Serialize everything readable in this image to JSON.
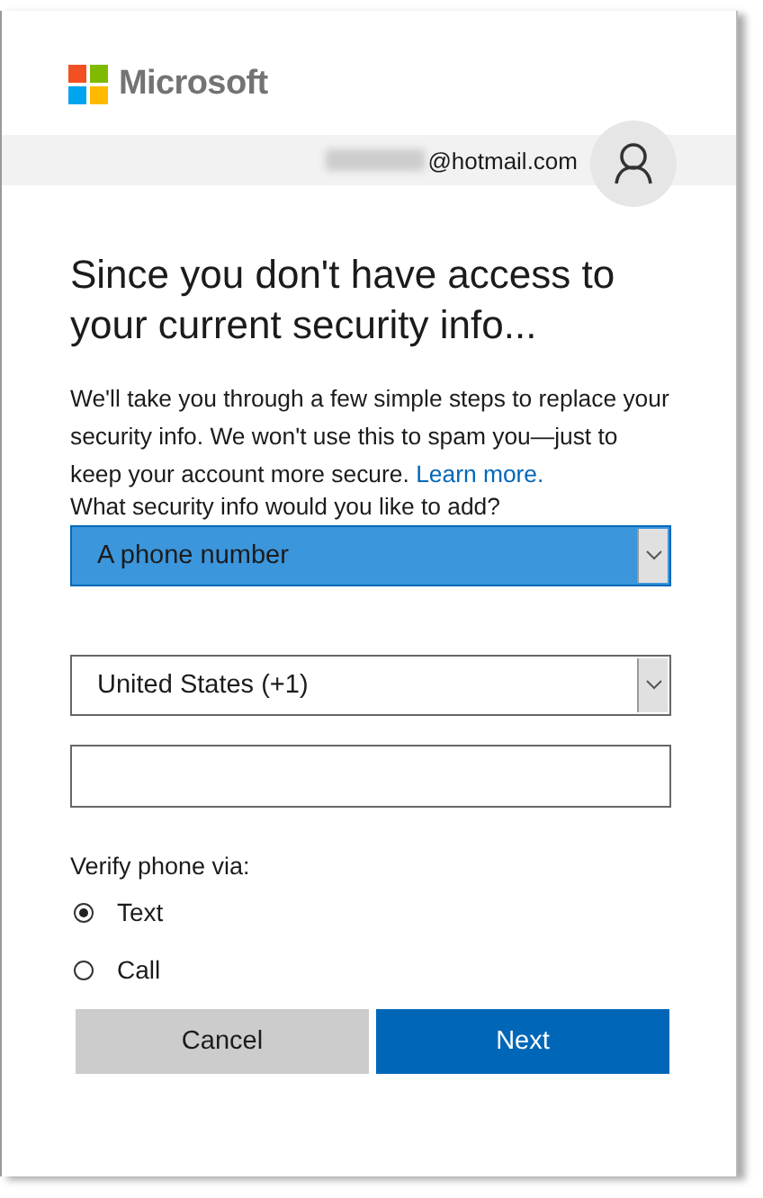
{
  "header": {
    "logo": "Microsoft",
    "account": "@hotmail.com"
  },
  "heading": "Since you don't have access to your current security info...",
  "intro": {
    "text": "We'll take you through a few simple steps to replace your security info. We won't use this to spam you—just to keep your account more secure.",
    "link": "Learn more."
  },
  "question": {
    "label": "What security info would you like to add?",
    "value": "A phone number",
    "focused": true
  },
  "country": {
    "value": "United States (+1)"
  },
  "verify": {
    "label": "Verify phone via:",
    "options": [
      {
        "label": "Text",
        "selected": true
      },
      {
        "label": "Call",
        "selected": false
      }
    ]
  },
  "buttons": [
    {
      "label": "Cancel",
      "kind": "secondary"
    },
    {
      "label": "Next",
      "kind": "primary"
    }
  ]
}
